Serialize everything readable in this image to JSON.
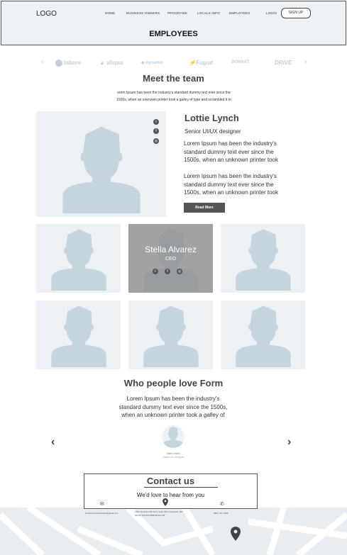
{
  "header": {
    "logo": "LOGO",
    "nav": [
      "HOME",
      "BUSINESS OWNERS",
      "PROGRAMS",
      "LOCALS INFO",
      "EMPLOYEES"
    ],
    "login": "LOGIN",
    "signup": "SIGN UP",
    "title": "EMPLOYEES"
  },
  "brands": [
    "labore",
    "aliqua",
    "dynamic",
    "Fugiat",
    "DONNAT",
    "DRIVE"
  ],
  "team": {
    "heading": "Meet the team",
    "intro_line1": "orem Ipsum has been the industry's standard dummy text ever since the",
    "intro_line2": "1500s, when an unknown printer took a galley of type and scrambled it to"
  },
  "featured": {
    "name": "Lottie Lynch",
    "role": "Senior UI/UX designer",
    "para1": [
      "Lorem Ipsum has been the industry's",
      "standard dummy text ever since the",
      "1500s, when an unknown printer took"
    ],
    "para2": [
      "Lorem Ipsum has been the industry's",
      "standard dummy text ever since the",
      "1500s, when an unknown printer took"
    ],
    "read_more": "Read More"
  },
  "hover_member": {
    "name": "Stella Alvarez",
    "role": "CEO"
  },
  "testimonials": {
    "heading": "Who people love Form",
    "lines": [
      "Lorem Ipsum has been the industry's",
      "standard dummy text ever since the 1500s,",
      "when an unknown printer took a galley of"
    ],
    "person_name": "Mark Green",
    "person_role": "Senior UX designer"
  },
  "contact": {
    "heading": "Contact us",
    "subheading": "We'd love to hear from you",
    "email": "businessconsultantsllc@gmail.com",
    "address_line1": "1801 Rosedal, MS Suite Suite 760, Columbus, MD",
    "address_line2": "(DCM) 346-527-8000 Bristol 3D",
    "phone": "(851) 737-7066"
  },
  "colors": {
    "placeholder_bg": "#ecf1f5",
    "silhouette": "#c6d4de",
    "dark_button": "#555555",
    "overlay": "#8c8c8c"
  }
}
